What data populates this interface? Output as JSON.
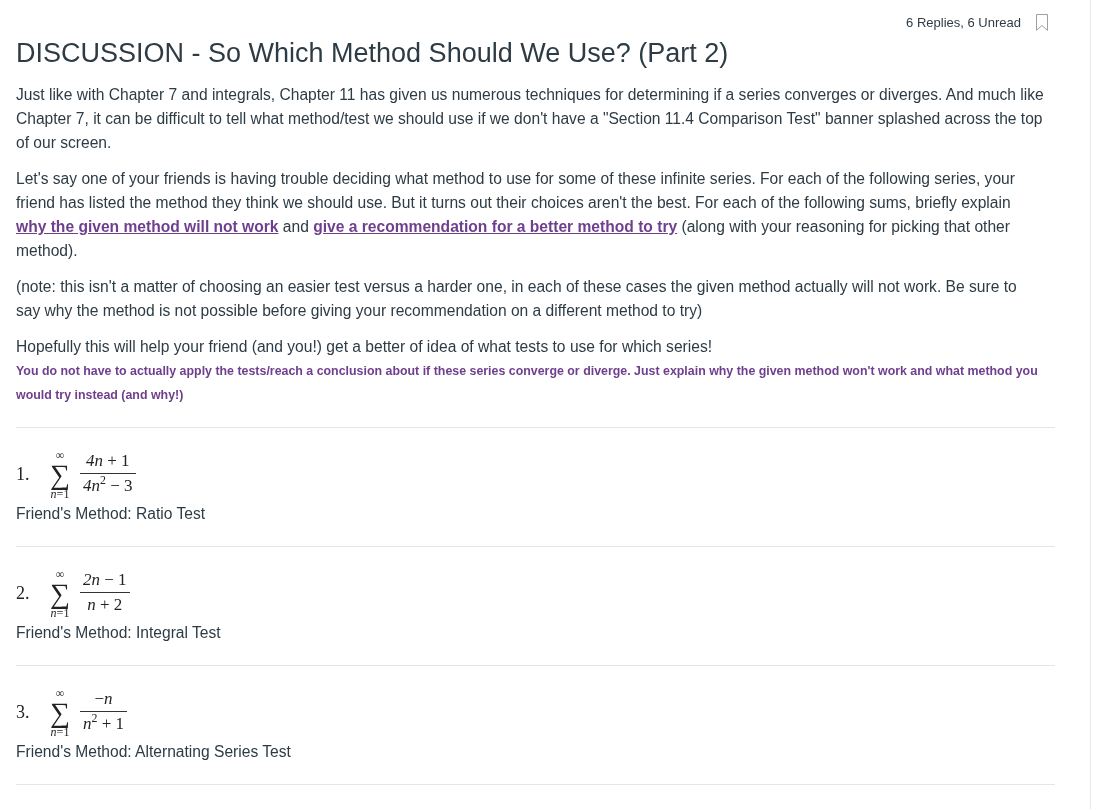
{
  "header": {
    "reply_count": "6 Replies, 6 Unread"
  },
  "title": "DISCUSSION - So Which Method Should We Use? (Part 2)",
  "paragraphs": [
    {
      "kind": "body",
      "text": "Just like with Chapter 7 and integrals, Chapter 11 has given us numerous techniques for determining if a series converges or diverges. And much like Chapter 7, it can be difficult to tell what method/test we should use if we don't have a \"Section 11.4 Comparison Test\" banner splashed across the top of our screen."
    },
    {
      "kind": "body",
      "segments": [
        {
          "text": "Let's say one of your friends is having trouble deciding what method to use for some of these infinite series. For each of the following series, your friend has listed the method they think we should use. But it turns out their choices aren't the best. For each of the following sums, briefly explain ",
          "emphasis": false
        },
        {
          "text": "why the given method will not work",
          "emphasis": true
        },
        {
          "text": " and ",
          "emphasis": false
        },
        {
          "text": "give a recommendation for a better method to try",
          "emphasis": true
        },
        {
          "text": " (along with your reasoning for picking that other method).",
          "emphasis": false
        }
      ]
    },
    {
      "kind": "body",
      "text": "(note: this isn't a matter of choosing an easier test versus a harder one, in each of these cases the given method actually will not work. Be sure to say why the method is not possible before giving your recommendation on a different method to try)"
    },
    {
      "kind": "body",
      "text": "Hopefully this will help your friend (and you!) get a better of idea of what tests to use for which series!"
    },
    {
      "kind": "note",
      "text": "You do not have to actually apply the tests/reach a conclusion about if these series converge or diverge. Just explain why the given method won't work and what method you would try instead (and why!)"
    }
  ],
  "problems": [
    {
      "number": "1.",
      "upper": "∞",
      "operator": "∑",
      "lower": "*n*=1",
      "numerator": "*4n* + 1",
      "denominator": "*4n*$^{2}$ − 3",
      "method": "Friend's Method: Ratio Test"
    },
    {
      "number": "2.",
      "upper": "∞",
      "operator": "∑",
      "lower": "*n*=1",
      "numerator": "*2n* − 1",
      "denominator": "*n* + 2",
      "method": "Friend's Method: Integral Test"
    },
    {
      "number": "3.",
      "upper": "∞",
      "operator": "∑",
      "lower": "*n*=1",
      "numerator": "−*n*",
      "denominator": "*n*$^{2}$ + 1",
      "method": "Friend's Method: Alternating Series Test"
    }
  ]
}
